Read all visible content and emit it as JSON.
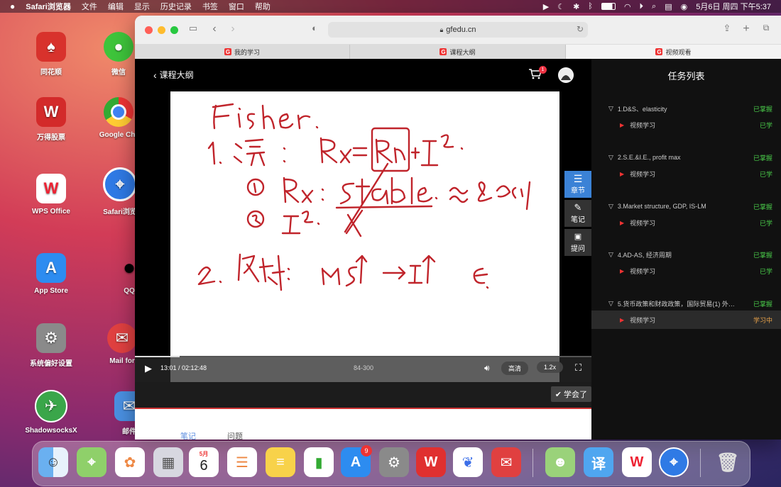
{
  "menubar": {
    "apple": "",
    "app_name": "Safari浏览器",
    "menus": [
      "文件",
      "编辑",
      "显示",
      "历史记录",
      "书签",
      "窗口",
      "帮助"
    ],
    "clock": "5月6日 周四 下午5:37"
  },
  "desktop_icons": [
    {
      "label": "同花顺",
      "color": "#d8322c",
      "glyph": "♠"
    },
    {
      "label": "微信",
      "color": "#3ec43b",
      "glyph": "💬"
    },
    {
      "label": "万得股票",
      "color": "#d32a2a",
      "glyph": "W"
    },
    {
      "label": "Google Chr",
      "color": "#ffffff",
      "glyph": "◎"
    },
    {
      "label": "WPS Office",
      "color": "#ffffff",
      "glyph": "W"
    },
    {
      "label": "Safari浏览",
      "color": "#2f7ae5",
      "glyph": "⌖"
    },
    {
      "label": "App Store",
      "color": "#2d8cf0",
      "glyph": "A"
    },
    {
      "label": "QQ",
      "color": "#111111",
      "glyph": "🐧"
    },
    {
      "label": "系统偏好设置",
      "color": "#8a8a8a",
      "glyph": "⚙"
    },
    {
      "label": "Mail for",
      "color": "#e04040",
      "glyph": "✉"
    },
    {
      "label": "ShadowsocksX",
      "color": "#3aa64a",
      "glyph": "✈"
    },
    {
      "label": "邮件",
      "color": "#4a90e2",
      "glyph": "✉"
    }
  ],
  "browser": {
    "url": "gfedu.cn",
    "tabs": [
      {
        "label": "我的学习",
        "active": false
      },
      {
        "label": "课程大纲",
        "active": false
      },
      {
        "label": "视频观看",
        "active": true
      }
    ]
  },
  "player": {
    "back_label": "课程大纲",
    "cart_count": "1",
    "time": "13:01 / 02:12:48",
    "page_indicator": "84-300",
    "quality": "高清",
    "speed": "1.2x",
    "progress_fraction": 0.098,
    "side_buttons": [
      {
        "label": "章节",
        "icon": "list-icon",
        "active": true
      },
      {
        "label": "笔记",
        "icon": "pencil-icon",
        "active": false
      },
      {
        "label": "提问",
        "icon": "question-icon",
        "active": false
      }
    ],
    "learned_label": "学会了",
    "bottom_tabs": [
      "笔记",
      "问题"
    ]
  },
  "tasks": {
    "title": "任务列表",
    "chapters": [
      {
        "title": "1.D&S、elasticity",
        "status": "已掌握",
        "item": "视频学习",
        "item_status": "已学",
        "current": false
      },
      {
        "title": "2.S.E.&I.E., profit max",
        "status": "已掌握",
        "item": "视频学习",
        "item_status": "已学",
        "current": false
      },
      {
        "title": "3.Market structure, GDP, IS-LM",
        "status": "已掌握",
        "item": "视频学习",
        "item_status": "已学",
        "current": false
      },
      {
        "title": "4.AD-AS, 经济周期",
        "status": "已掌握",
        "item": "视频学习",
        "item_status": "已学",
        "current": false
      },
      {
        "title": "5.货币政策和财政政策，国际贸易(1) 外…",
        "status": "已掌握",
        "item": "视频学习",
        "item_status": "学习中",
        "current": true
      }
    ]
  },
  "dock": {
    "appstore_badge": "9",
    "calendar_month": "5月",
    "calendar_day": "6"
  }
}
